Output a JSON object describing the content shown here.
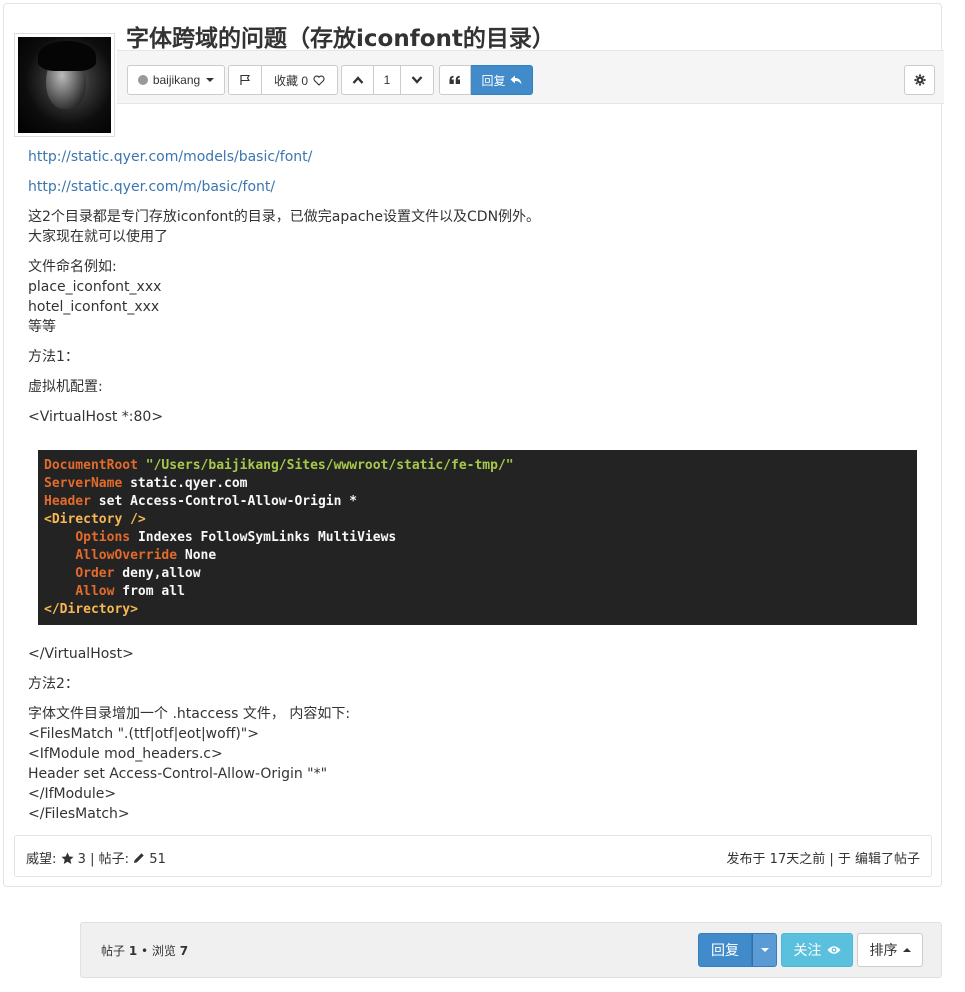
{
  "post": {
    "title": "字体跨域的问题（存放iconfont的目录）",
    "author": "baijikang",
    "bookmark_label": "收藏 0",
    "vote_count": "1",
    "reply_label": "回复"
  },
  "content": {
    "link1": "http://static.qyer.com/models/basic/font/",
    "link2": "http://static.qyer.com/m/basic/font/",
    "para1_line1": "这2个目录都是专门存放iconfont的目录，已做完apache设置文件以及CDN例外。",
    "para1_line2": "大家现在就可以使用了",
    "naming_line1": "文件命名例如:",
    "naming_line2": "place_iconfont_xxx",
    "naming_line3": "hotel_iconfont_xxx",
    "naming_line4": "等等",
    "method1": "方法1：",
    "vhost_config": "虚拟机配置:",
    "vhost_open": "<VirtualHost *:80>",
    "vhost_close": "</VirtualHost>",
    "method2": "方法2：",
    "m2_line1": "字体文件目录增加一个 .htaccess 文件，  内容如下:",
    "m2_line2": "<FilesMatch \".(ttf|otf|eot|woff)\">",
    "m2_line3": "<IfModule mod_headers.c>",
    "m2_line4": "Header set Access-Control-Allow-Origin \"*\"",
    "m2_line5": "</IfModule>",
    "m2_line6": "</FilesMatch>"
  },
  "code": {
    "l1_kw": "DocumentRoot",
    "l1_str": "\"/Users/baijikang/Sites/wwwroot/static/fe-tmp/\"",
    "l2_kw": "ServerName",
    "l2_val": "static.qyer.com",
    "l3_kw": "Header",
    "l3_val": "set Access-Control-Allow-Origin *",
    "l4_tag": "<Directory />",
    "l5_kw": "Options",
    "l5_val": "Indexes FollowSymLinks MultiViews",
    "l6_kw": "AllowOverride",
    "l6_val": "None",
    "l7_kw": "Order",
    "l7_val": "deny,allow",
    "l8_kw": "Allow",
    "l8_val": "from all",
    "l9_tag": "</Directory>"
  },
  "footer": {
    "reputation_label": "威望:",
    "reputation_value": "3",
    "separator": "|",
    "posts_label": "帖子:",
    "posts_value": "51",
    "published": "发布于 17天之前 | 于 编辑了帖子"
  },
  "bottom": {
    "posts_label": "帖子",
    "posts_count": "1",
    "views_label": "• 浏览",
    "views_count": "7",
    "reply_label": "回复",
    "follow_label": "关注",
    "sort_label": "排序"
  },
  "icons": {
    "flag": "flag-icon",
    "heart": "heart-icon",
    "up": "chevron-up-icon",
    "down": "chevron-down-icon",
    "quote": "quote-icon",
    "reply": "reply-icon",
    "gear": "gear-icon",
    "star": "star-icon",
    "pencil": "pencil-icon",
    "eye": "eye-icon"
  },
  "colors": {
    "primary": "#428bca",
    "info": "#5bc0de",
    "link": "#3a75b0",
    "code_bg": "#232323",
    "code_keyword": "#e26b2c",
    "code_string": "#a6c94a",
    "code_tag": "#f7b754"
  }
}
